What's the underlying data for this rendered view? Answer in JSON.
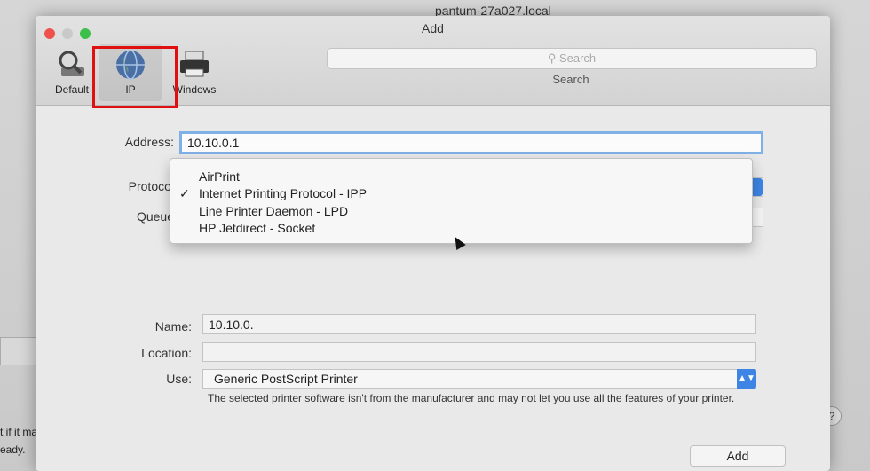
{
  "background": {
    "window_title": "pantum-27a027.local",
    "left_texts": [
      "t if it matc",
      "eady."
    ],
    "help_label": "?"
  },
  "dialog": {
    "title": "Add",
    "toolbar": [
      {
        "label": "Default",
        "icon": "magnifier-printer-icon"
      },
      {
        "label": "IP",
        "icon": "globe-icon"
      },
      {
        "label": "Windows",
        "icon": "printer-icon"
      }
    ],
    "search": {
      "placeholder": "Search",
      "caption": "Search"
    }
  },
  "form": {
    "address_label": "Address:",
    "address_value": "10.10.0.1",
    "protocol_label": "Protocol",
    "queue_label": "Queue",
    "name_label": "Name:",
    "name_value": "10.10.0.",
    "location_label": "Location:",
    "location_value": "",
    "use_label": "Use:",
    "use_value": "Generic PostScript Printer",
    "note": "The selected printer software isn't from the manufacturer and may not let you use all the features of your printer."
  },
  "protocol_menu": {
    "items": [
      {
        "label": "AirPrint",
        "checked": false
      },
      {
        "label": "Internet Printing Protocol - IPP",
        "checked": true
      },
      {
        "label": "Line Printer Daemon - LPD",
        "checked": false
      },
      {
        "label": "HP Jetdirect - Socket",
        "checked": false
      }
    ],
    "check_mark": "✓"
  },
  "buttons": {
    "add": "Add"
  },
  "colors": {
    "accent": "#3d84e5",
    "highlight": "#e01010",
    "close": "#f0504a",
    "minimize": "#c9c9c9",
    "zoom": "#3cc04a"
  }
}
